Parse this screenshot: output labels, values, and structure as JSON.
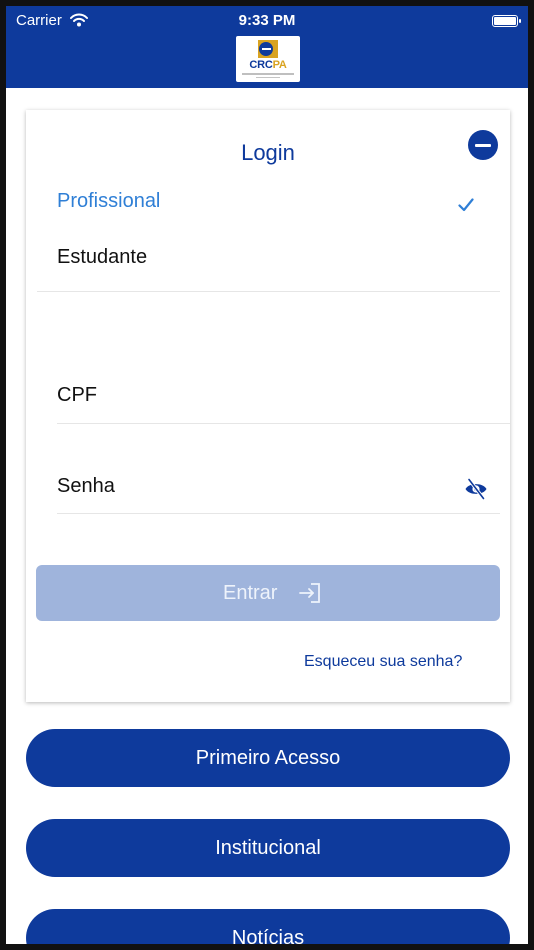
{
  "status_bar": {
    "carrier": "Carrier",
    "time": "9:33 PM"
  },
  "header": {
    "logo": {
      "brand_left": "CRC",
      "brand_right": "PA"
    },
    "background_color": "#0e3a9c"
  },
  "login_card": {
    "title": "Login",
    "collapse_icon": "minus-circle-icon",
    "user_types": [
      {
        "label": "Profissional",
        "selected": true
      },
      {
        "label": "Estudante",
        "selected": false
      }
    ],
    "cpf_label": "CPF",
    "password_label": "Senha",
    "password_toggle_icon": "eye-slash-icon",
    "submit_label": "Entrar",
    "submit_icon": "sign-in-icon",
    "forgot_password": "Esqueceu sua senha?"
  },
  "actions": [
    {
      "label": "Primeiro Acesso"
    },
    {
      "label": "Institucional"
    },
    {
      "label": "Notícias"
    }
  ],
  "colors": {
    "primary": "#0e3a9c",
    "selected_option": "#2f7fd6",
    "disabled_button": "#9fb4dc",
    "logo_accent": "#d9a321"
  }
}
